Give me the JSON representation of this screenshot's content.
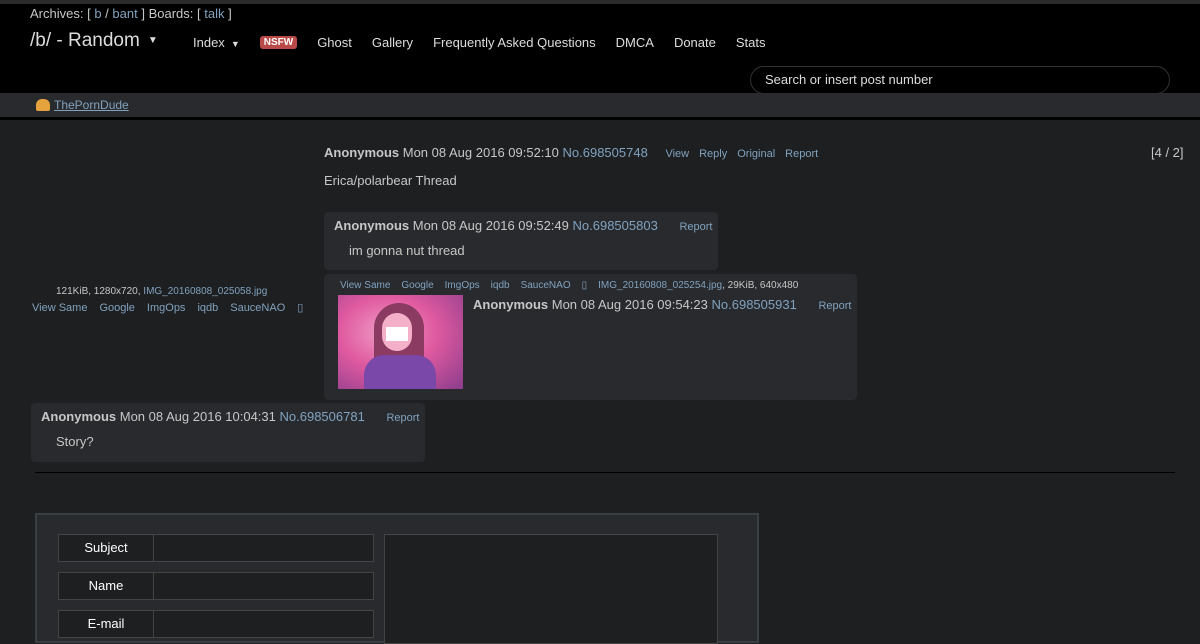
{
  "header": {
    "archives_label": "Archives: [",
    "archives_b": "b",
    "archives_sep": "/",
    "archives_bant": "bant",
    "boards_label": "] Boards: [",
    "boards_talk": "talk",
    "boards_close": "]",
    "title": "/b/ - Random",
    "nav": {
      "index": "Index",
      "nsfw": "NSFW",
      "ghost": "Ghost",
      "gallery": "Gallery",
      "faq": "Frequently Asked Questions",
      "dmca": "DMCA",
      "donate": "Donate",
      "stats": "Stats"
    },
    "search_placeholder": "Search or insert post number"
  },
  "sponsor": {
    "label": "ThePornDude"
  },
  "op": {
    "name": "Anonymous",
    "date": "Mon 08 Aug 2016 09:52:10",
    "number": "No.698505748",
    "controls": [
      "View",
      "Reply",
      "Original",
      "Report"
    ],
    "text": "Erica/polarbear Thread",
    "counter": "[4 / 2]",
    "file": {
      "info": "121KiB, 1280x720,",
      "filename": "IMG_20160808_025058.jpg",
      "tools": [
        "View Same",
        "Google",
        "ImgOps",
        "iqdb",
        "SauceNAO",
        "▯"
      ]
    }
  },
  "replies": [
    {
      "name": "Anonymous",
      "date": "Mon 08 Aug 2016 09:52:49",
      "number": "No.698505803",
      "report": "Report",
      "text": "im gonna nut thread"
    },
    {
      "name": "Anonymous",
      "date": "Mon 08 Aug 2016 09:54:23",
      "number": "No.698505931",
      "report": "Report",
      "file": {
        "tools": [
          "View Same",
          "Google",
          "ImgOps",
          "iqdb",
          "SauceNAO",
          "▯"
        ],
        "filename": "IMG_20160808_025254.jpg",
        "meta": ", 29KiB, 640x480"
      }
    },
    {
      "name": "Anonymous",
      "date": "Mon 08 Aug 2016 10:04:31",
      "number": "No.698506781",
      "report": "Report",
      "text": "Story?"
    }
  ],
  "form": {
    "subject": "Subject",
    "name": "Name",
    "email": "E-mail"
  },
  "colors": {
    "accent": "#81a2be",
    "nsfw": "#b94a48",
    "background": "#1d1f21"
  }
}
